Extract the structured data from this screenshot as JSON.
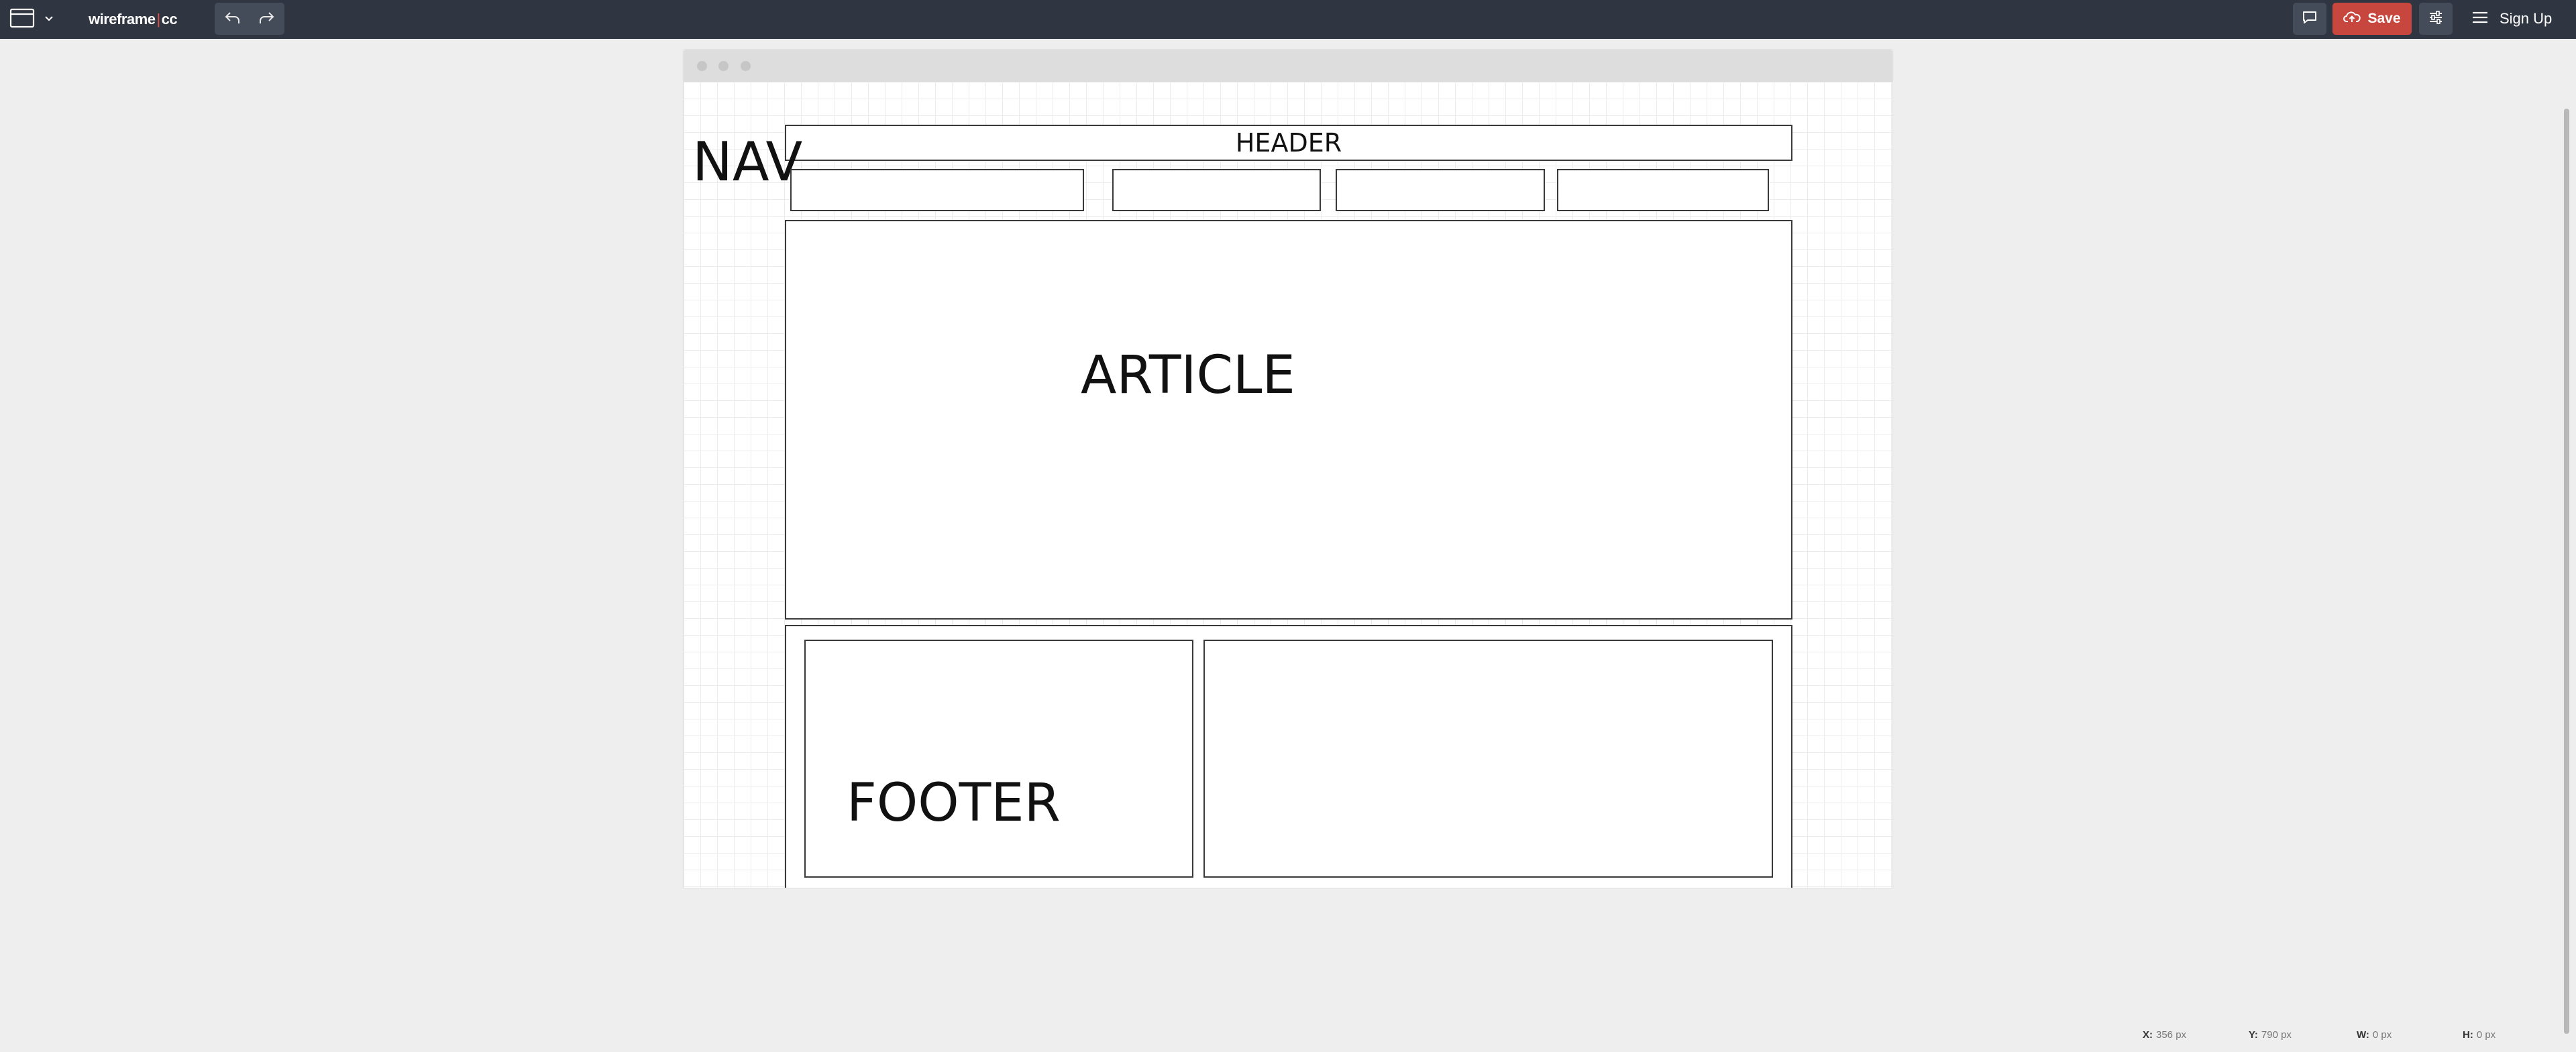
{
  "app": {
    "logo_left": "wireframe",
    "logo_separator": "|",
    "logo_right": "cc"
  },
  "toolbar": {
    "page_menu_icon": "browser-window-icon",
    "page_menu_caret": "chevron-down-icon",
    "undo_icon": "undo-icon",
    "redo_icon": "redo-icon",
    "comment_icon": "comment-icon",
    "save_label": "Save",
    "save_icon": "cloud-upload-icon",
    "settings_icon": "sliders-icon",
    "menu_icon": "hamburger-icon",
    "signup_label": "Sign Up",
    "save_color": "#c7463e",
    "bar_color": "#2f3541"
  },
  "canvas": {
    "frame_style": "browser",
    "header_label": "HEADER",
    "nav_label": "NAV",
    "nav_boxes": 4,
    "article_label": "ARTICLE",
    "footer_label": "FOOTER"
  },
  "status": {
    "x_label": "X:",
    "x_value": "356 px",
    "y_label": "Y:",
    "y_value": "790 px",
    "w_label": "W:",
    "w_value": "0 px",
    "h_label": "H:",
    "h_value": "0 px"
  }
}
